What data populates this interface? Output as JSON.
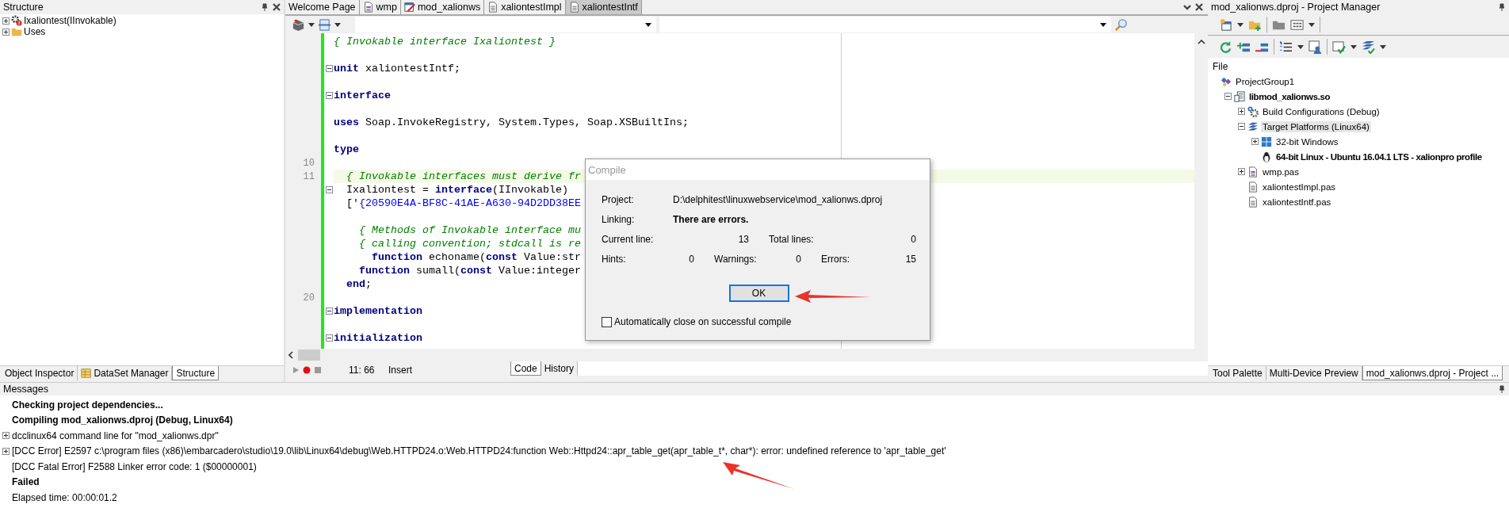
{
  "structure": {
    "title": "Structure",
    "tree": [
      {
        "label": "Ixaliontest(IInvokable)",
        "kind": "interface",
        "expanded": false
      },
      {
        "label": "Uses",
        "kind": "folder",
        "expanded": false
      }
    ],
    "tabs": [
      {
        "label": "Object Inspector",
        "kind": "plain",
        "selected": false
      },
      {
        "label": "DataSet Manager",
        "kind": "dataset",
        "selected": false
      },
      {
        "label": "Structure",
        "kind": "plain",
        "selected": true
      }
    ]
  },
  "editor": {
    "tabs": [
      {
        "label": "Welcome Page",
        "kind": "plain",
        "selected": false
      },
      {
        "label": "wmp",
        "kind": "form",
        "selected": false
      },
      {
        "label": "mod_xalionws",
        "kind": "project",
        "selected": false
      },
      {
        "label": "xaliontestImpl",
        "kind": "file",
        "selected": false
      },
      {
        "label": "xaliontestIntf",
        "kind": "file",
        "selected": true
      }
    ],
    "code": [
      {
        "tokens": [
          {
            "kind": "comment",
            "text": "{ Invokable interface Ixaliontest }"
          }
        ],
        "highlighted": false,
        "fold": false
      },
      {
        "highlighted": false,
        "fold": false
      },
      {
        "tokens": [
          {
            "kind": "keyword",
            "text": "unit"
          },
          {
            "kind": "plain",
            "text": " xaliontestIntf;"
          }
        ],
        "highlighted": false,
        "fold": true
      },
      {
        "highlighted": false,
        "fold": false
      },
      {
        "tokens": [
          {
            "kind": "keyword",
            "text": "interface"
          }
        ],
        "highlighted": false,
        "fold": true
      },
      {
        "highlighted": false,
        "fold": false
      },
      {
        "tokens": [
          {
            "kind": "keyword",
            "text": "uses"
          },
          {
            "kind": "plain",
            "text": " Soap.InvokeRegistry, System.Types, Soap.XSBuiltIns;"
          }
        ],
        "highlighted": false,
        "fold": false
      },
      {
        "highlighted": false,
        "fold": false
      },
      {
        "tokens": [
          {
            "kind": "keyword",
            "text": "type"
          }
        ],
        "highlighted": false,
        "fold": false
      },
      {
        "number": "10",
        "highlighted": false,
        "fold": false
      },
      {
        "number": "11",
        "tokens": [
          {
            "kind": "comment",
            "text": "  { Invokable interfaces must derive fr"
          }
        ],
        "highlighted": true,
        "fold": false
      },
      {
        "tokens": [
          {
            "kind": "plain",
            "text": "  Ixaliontest = "
          },
          {
            "kind": "keyword",
            "text": "interface"
          },
          {
            "kind": "plain",
            "text": "(IInvokable)"
          }
        ],
        "highlighted": false,
        "fold": true
      },
      {
        "tokens": [
          {
            "kind": "plain",
            "text": "  ['"
          },
          {
            "kind": "string",
            "text": "{20590E4A-BF8C-41AE-A630-94D2DD38EE"
          }
        ],
        "highlighted": false,
        "fold": false
      },
      {
        "highlighted": false,
        "fold": false
      },
      {
        "tokens": [
          {
            "kind": "comment",
            "text": "    { Methods of Invokable interface mu"
          }
        ],
        "highlighted": false,
        "fold": false
      },
      {
        "tokens": [
          {
            "kind": "comment",
            "text": "    { calling convention; stdcall is re"
          }
        ],
        "highlighted": false,
        "fold": false
      },
      {
        "tokens": [
          {
            "kind": "keyword",
            "text": "      function"
          },
          {
            "kind": "plain",
            "text": " echoname("
          },
          {
            "kind": "keyword",
            "text": "const"
          },
          {
            "kind": "plain",
            "text": " Value:str"
          }
        ],
        "highlighted": false,
        "fold": false
      },
      {
        "tokens": [
          {
            "kind": "keyword",
            "text": "    function"
          },
          {
            "kind": "plain",
            "text": " sumall("
          },
          {
            "kind": "keyword",
            "text": "const"
          },
          {
            "kind": "plain",
            "text": " Value:integer"
          }
        ],
        "highlighted": false,
        "fold": false
      },
      {
        "tokens": [
          {
            "kind": "keyword",
            "text": "  end"
          },
          {
            "kind": "plain",
            "text": ";"
          }
        ],
        "highlighted": false,
        "fold": false
      },
      {
        "number": "20",
        "highlighted": false,
        "fold": false
      },
      {
        "tokens": [
          {
            "kind": "keyword",
            "text": "implementation"
          }
        ],
        "highlighted": false,
        "fold": true
      },
      {
        "highlighted": false,
        "fold": false
      },
      {
        "tokens": [
          {
            "kind": "keyword",
            "text": "initialization"
          }
        ],
        "highlighted": false,
        "fold": true
      }
    ],
    "status": {
      "position": "11: 66",
      "mode": "Insert"
    },
    "view_tabs": [
      {
        "label": "Code",
        "selected": true
      },
      {
        "label": "History",
        "selected": false
      }
    ]
  },
  "dialog": {
    "title": "Compile",
    "project_label": "Project:",
    "project": "D:\\delphitest\\linuxwebservice\\mod_xalionws.dproj",
    "linking_label": "Linking:",
    "linking": "There are errors.",
    "current_line_label": "Current line:",
    "current_line": "13",
    "total_lines_label": "Total lines:",
    "total_lines": "0",
    "hints_label": "Hints:",
    "hints": "0",
    "warnings_label": "Warnings:",
    "warnings": "0",
    "errors_label": "Errors:",
    "errors": "15",
    "button": "OK",
    "checkbox": {
      "label": "Automatically close on successful compile",
      "checked": false
    }
  },
  "project_manager": {
    "title": "mod_xalionws.dproj - Project Manager",
    "header": "File",
    "tree": [
      {
        "label": "ProjectGroup1",
        "kind": "group",
        "selected": false,
        "active": false,
        "children": [
          {
            "label": "libmod_xalionws.so",
            "kind": "library",
            "expanded": true,
            "selected": false,
            "active": true,
            "children": [
              {
                "label": "Build Configurations (Debug)",
                "kind": "gear",
                "expanded": false,
                "selected": false,
                "active": false
              },
              {
                "label": "Target Platforms (Linux64)",
                "kind": "platforms",
                "expanded": true,
                "selected": true,
                "active": false,
                "children": [
                  {
                    "label": "32-bit Windows",
                    "kind": "windows",
                    "expanded": false,
                    "selected": false,
                    "active": false
                  },
                  {
                    "label": "64-bit Linux - Ubuntu 16.04.1 LTS - xalionpro profile",
                    "kind": "linux",
                    "selected": false,
                    "active": true
                  }
                ]
              },
              {
                "label": "wmp.pas",
                "kind": "form",
                "expanded": false,
                "selected": false,
                "active": false
              },
              {
                "label": "xaliontestImpl.pas",
                "kind": "file",
                "selected": false,
                "active": false
              },
              {
                "label": "xaliontestIntf.pas",
                "kind": "file",
                "selected": false,
                "active": false
              }
            ]
          }
        ]
      }
    ],
    "tabs": [
      {
        "label": "Tool Palette",
        "selected": false
      },
      {
        "label": "Multi-Device Preview",
        "selected": false
      },
      {
        "label": "mod_xalionws.dproj - Project ...",
        "selected": true
      }
    ]
  },
  "messages": {
    "title": "Messages",
    "lines": [
      {
        "text": "Checking project dependencies...",
        "bold": true,
        "expandable": false
      },
      {
        "text": "Compiling mod_xalionws.dproj (Debug, Linux64)",
        "bold": true,
        "expandable": false
      },
      {
        "text": "dcclinux64 command line for \"mod_xalionws.dpr\"",
        "bold": false,
        "expandable": true
      },
      {
        "text": "[DCC Error] E2597 c:\\program files (x86)\\embarcadero\\studio\\19.0\\lib\\Linux64\\debug\\Web.HTTPD24.o:Web.HTTPD24:function Web::Httpd24::apr_table_get(apr_table_t*, char*): error: undefined reference to 'apr_table_get'",
        "bold": false,
        "expandable": true
      },
      {
        "text": "[DCC Fatal Error] F2588 Linker error code: 1 ($00000001)",
        "bold": false,
        "expandable": false
      },
      {
        "text": "Failed",
        "bold": true,
        "expandable": false
      },
      {
        "text": "Elapsed time: 00:00:01.2",
        "bold": false,
        "expandable": false
      }
    ]
  }
}
